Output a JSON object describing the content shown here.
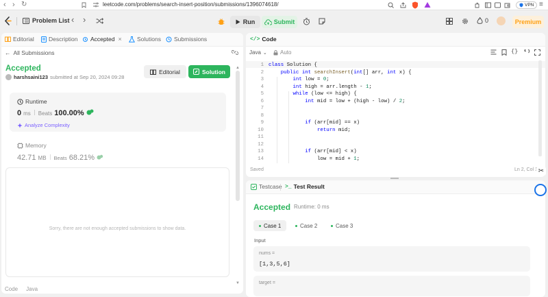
{
  "browser": {
    "url": "leetcode.com/problems/search-insert-position/submissions/1396074618/",
    "vpn_label": "VPN"
  },
  "topbar": {
    "problem_list": "Problem List",
    "run": "Run",
    "submit": "Submit",
    "streak_count": "0",
    "premium": "Premium"
  },
  "left": {
    "tabs": [
      "Editorial",
      "Description",
      "Accepted",
      "Solutions",
      "Submissions"
    ],
    "all_submissions": "All Submissions",
    "status": "Accepted",
    "user": "harshsaini123",
    "submitted_at": "submitted at Sep 20, 2024 09:28",
    "editorial_btn": "Editorial",
    "solution_btn": "Solution",
    "runtime_label": "Runtime",
    "runtime_value": "0",
    "runtime_unit": "ms",
    "beats_label": "Beats",
    "runtime_beats": "100.00%",
    "analyze": "Analyze Complexity",
    "memory_label": "Memory",
    "memory_value": "42.71",
    "memory_unit": "MB",
    "memory_beats": "68.21%",
    "empty_msg": "Sorry, there are not enough accepted submissions to show data.",
    "bottom_tabs": [
      "Code",
      "Java"
    ]
  },
  "code": {
    "tab": "Code",
    "language": "Java",
    "auto": "Auto",
    "saved": "Saved",
    "cursor": "Ln 2, Col 1",
    "lines": [
      "class Solution {",
      "    public int searchInsert(int[] arr, int x) {",
      "        int low = 0;",
      "        int high = arr.length - 1;",
      "        while (low <= high) {",
      "            int mid = low + (high - low) / 2;",
      "",
      "",
      "            if (arr[mid] == x)",
      "                return mid;",
      "",
      "",
      "            if (arr[mid] < x)",
      "                low = mid + 1;"
    ]
  },
  "test": {
    "tab_testcase": "Testcase",
    "tab_result": "Test Result",
    "status": "Accepted",
    "runtime": "Runtime: 0 ms",
    "cases": [
      "Case 1",
      "Case 2",
      "Case 3"
    ],
    "input_label": "Input",
    "var1_name": "nums =",
    "var1_value": "[1,3,5,6]",
    "var2_name": "target ="
  },
  "colors": {
    "green": "#2db55d",
    "orange": "#ffa116",
    "blue": "#007aff"
  }
}
